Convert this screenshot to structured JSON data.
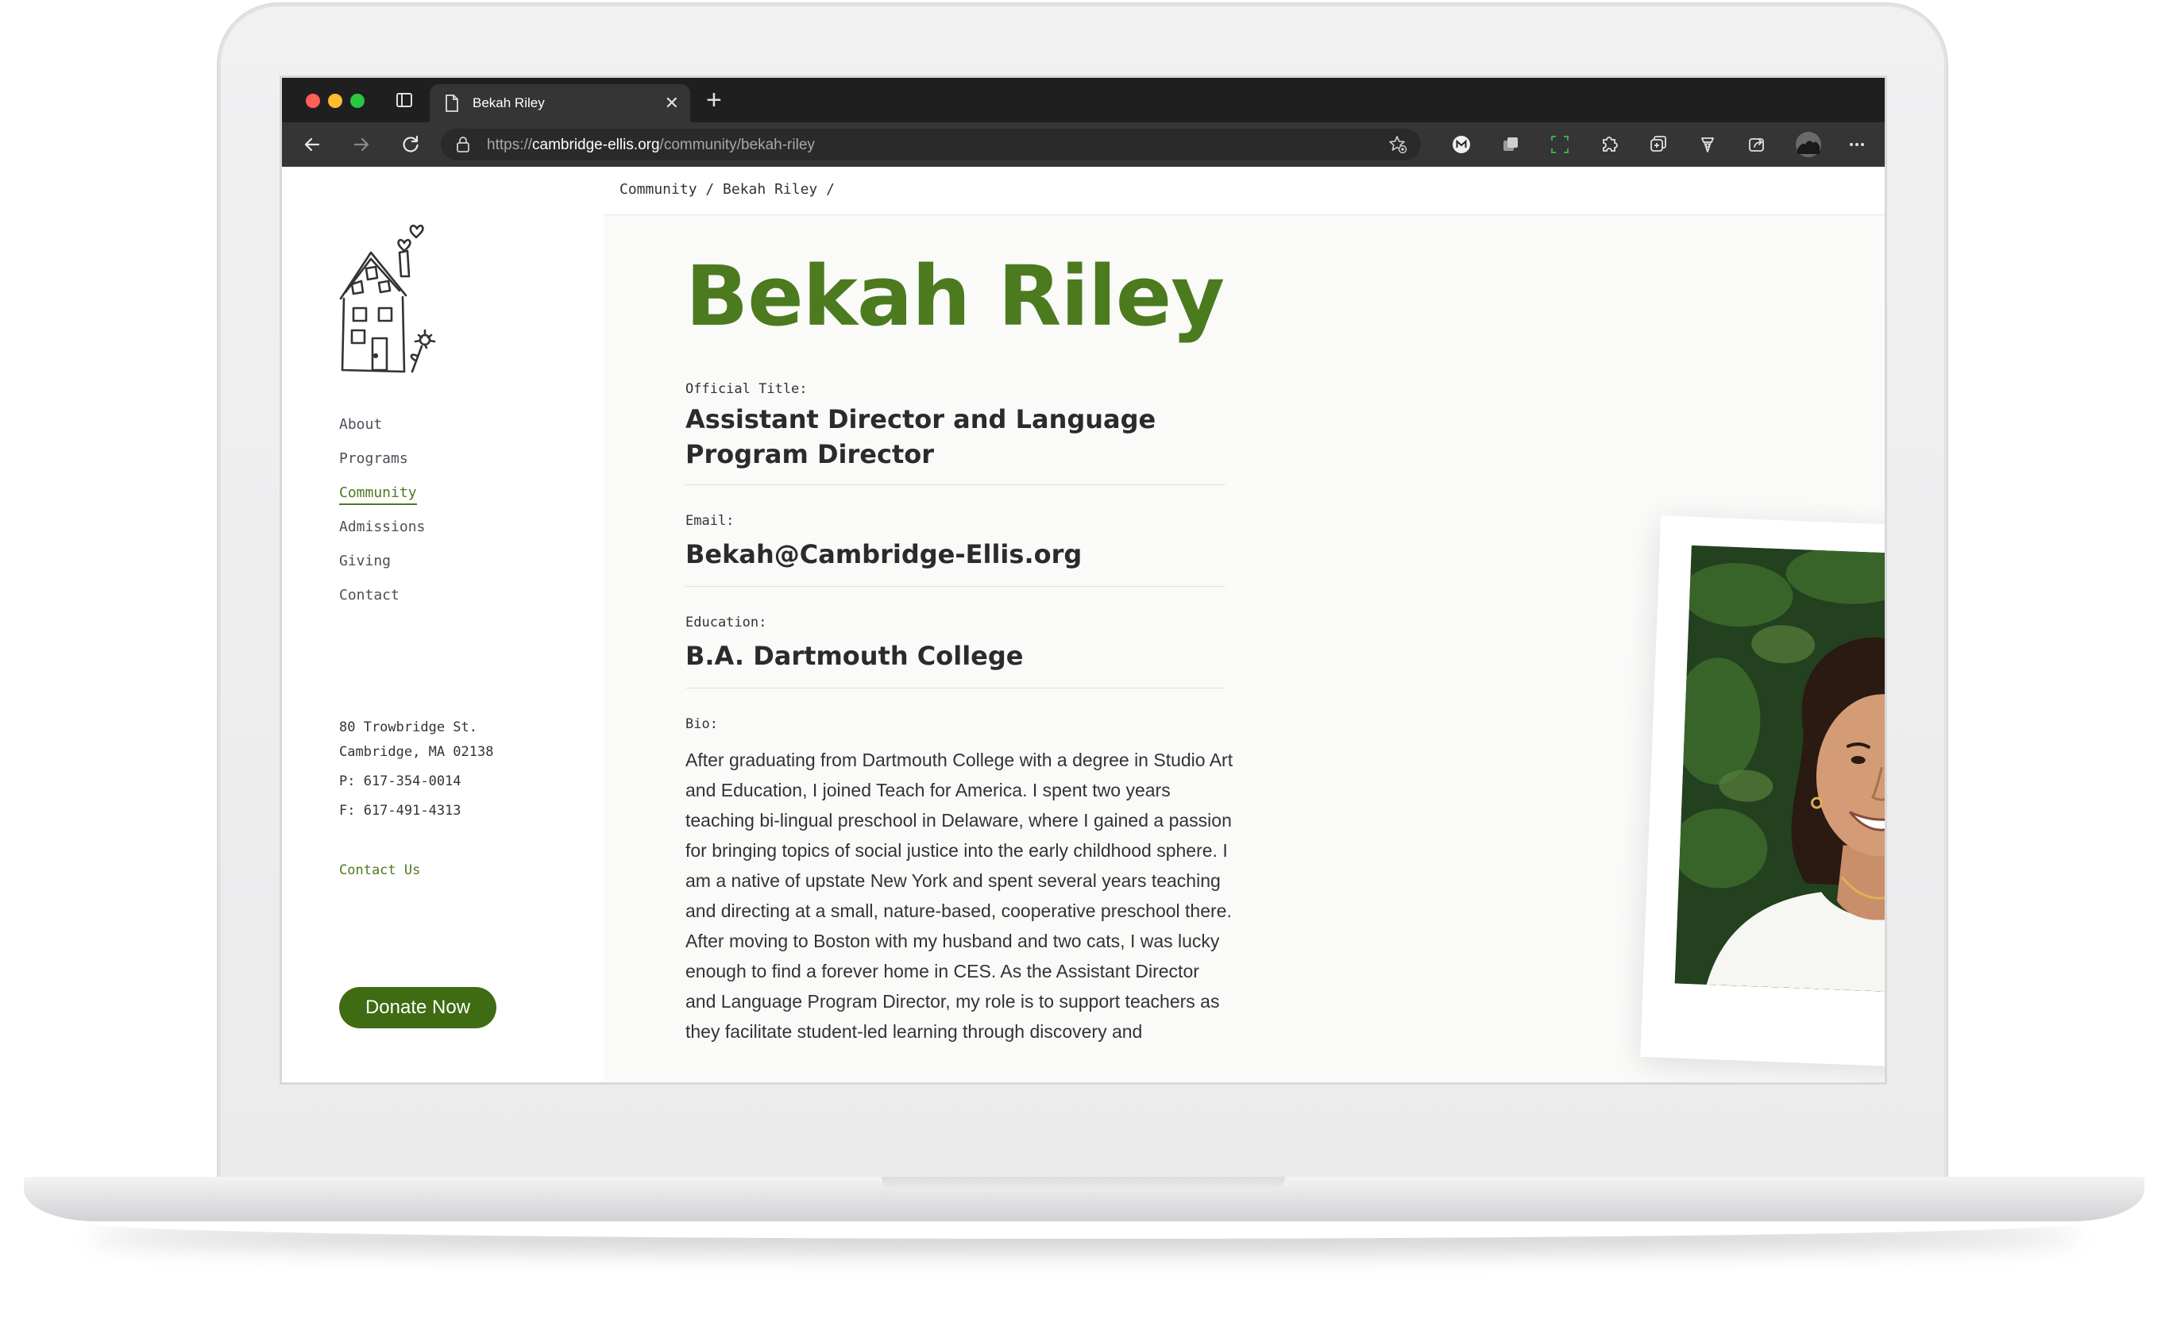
{
  "browser": {
    "tab_title": "Bekah Riley",
    "url_scheme": "https://",
    "url_host": "cambridge-ellis.org",
    "url_path": "/community/bekah-riley"
  },
  "sidebar": {
    "nav": [
      {
        "label": "About",
        "active": false
      },
      {
        "label": "Programs",
        "active": false
      },
      {
        "label": "Community",
        "active": true
      },
      {
        "label": "Admissions",
        "active": false
      },
      {
        "label": "Giving",
        "active": false
      },
      {
        "label": "Contact",
        "active": false
      }
    ],
    "address_line1": "80 Trowbridge St.",
    "address_line2": "Cambridge, MA 02138",
    "phone": "P: 617-354-0014",
    "fax": "F: 617-491-4313",
    "contact_link": "Contact Us",
    "donate_label": "Donate Now"
  },
  "breadcrumb": "Community / Bekah Riley /",
  "profile": {
    "name": "Bekah Riley",
    "title_label": "Official Title:",
    "title_value": "Assistant Director and Language Program Director",
    "email_label": "Email:",
    "email_value": "Bekah@Cambridge-Ellis.org",
    "education_label": "Education:",
    "education_value": "B.A. Dartmouth College",
    "bio_label": "Bio:",
    "bio_text": "After graduating from Dartmouth College with a degree in Studio Art and Education, I joined Teach for America. I spent two years teaching bi-lingual preschool in Delaware, where I gained a passion for bringing topics of social justice into the early childhood sphere. I am a native of upstate New York and spent several years teaching and directing at a small, nature-based, cooperative preschool there. After moving to Boston with my husband and two cats, I was lucky enough to find a forever home in CES. As the Assistant Director and Language Program Director, my role is to support teachers as they facilitate student-led learning through discovery and"
  },
  "colors": {
    "brand_green": "#4c7a1e",
    "donate_green": "#3f6b12"
  }
}
